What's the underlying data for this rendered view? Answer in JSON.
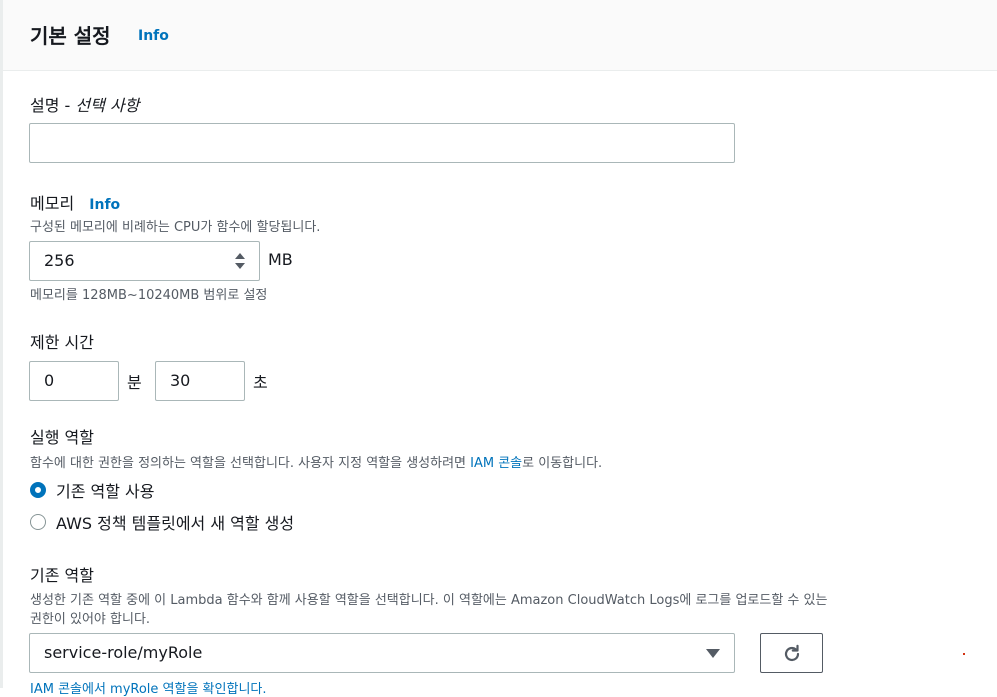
{
  "header": {
    "title": "기본 설정",
    "info": "Info"
  },
  "description": {
    "label_main": "설명 - ",
    "label_optional": "선택 사항",
    "value": ""
  },
  "memory": {
    "label": "메모리",
    "info": "Info",
    "help": "구성된 메모리에 비례하는 CPU가 함수에 할당됩니다.",
    "value": "256",
    "unit": "MB",
    "constraint": "메모리를 128MB~10240MB 범위로 설정"
  },
  "timeout": {
    "label": "제한 시간",
    "minutes_value": "0",
    "minutes_unit": "분",
    "seconds_value": "30",
    "seconds_unit": "초"
  },
  "execution_role": {
    "label": "실행 역할",
    "help_prefix": "함수에 대한 권한을 정의하는 역할을 선택합니다. 사용자 지정 역할을 생성하려면 ",
    "help_link": "IAM 콘솔",
    "help_suffix": "로 이동합니다.",
    "options": [
      {
        "label": "기존 역할 사용",
        "selected": true
      },
      {
        "label": "AWS 정책 템플릿에서 새 역할 생성",
        "selected": false
      }
    ]
  },
  "existing_role": {
    "label": "기존 역할",
    "help_line1": "생성한 기존 역할 중에 이 Lambda 함수와 함께 사용할 역할을 선택합니다. 이 역할에는 Amazon CloudWatch Logs에 로그를 업로드할 수 있는",
    "help_line2": "권한이 있어야 합니다.",
    "selected": "service-role/myRole",
    "refresh_icon": "refresh-icon",
    "footnote": "IAM 콘솔에서 myRole 역할을 확인합니다."
  },
  "colors": {
    "link": "#0073bb",
    "text": "#16191f",
    "secondary": "#545b64",
    "border": "#aab7b8"
  }
}
